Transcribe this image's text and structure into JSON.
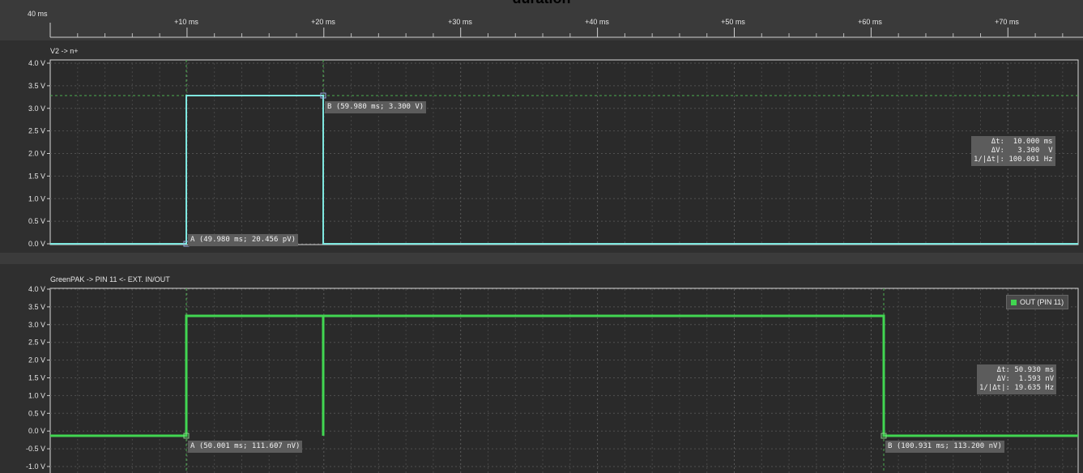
{
  "title": "duration",
  "ruler": {
    "origin_label": "40 ms",
    "ticks": [
      "+10 ms",
      "+20 ms",
      "+30 ms",
      "+40 ms",
      "+50 ms",
      "+60 ms",
      "+70 ms"
    ]
  },
  "y_labels_top": [
    "4.0 V",
    "3.5 V",
    "3.0 V",
    "2.5 V",
    "2.0 V",
    "1.5 V",
    "1.0 V",
    "0.5 V",
    "0.0 V"
  ],
  "y_labels_bottom": [
    "4.0 V",
    "3.5 V",
    "3.0 V",
    "2.5 V",
    "2.0 V",
    "1.5 V",
    "1.0 V",
    "0.5 V",
    "0.0 V",
    "-0.5 V",
    "-1.0 V"
  ],
  "panel1": {
    "channel_label": "V2 -> n+",
    "trace_color": "#7fe8e0",
    "marker_a": "A (49.980 ms; 20.456 pV)",
    "marker_b": "B (59.980 ms; 3.300 V)",
    "measure": {
      "dt": "Δt:  10.000 ms",
      "dv": "ΔV:   3.300  V",
      "freq": "1/|Δt|: 100.001 Hz"
    }
  },
  "panel2": {
    "channel_label": "GreenPAK -> PIN 11 <- EXT. IN/OUT",
    "trace_color": "#41d651",
    "legend": "OUT (PIN 11)",
    "marker_a": "A (50.001 ms; 111.607 nV)",
    "marker_b": "B (100.931 ms; 113.200 nV)",
    "measure": {
      "dt": "Δt: 50.930 ms",
      "dv": "ΔV:  1.593 nV",
      "freq": "1/|Δt|: 19.635 Hz"
    }
  }
}
